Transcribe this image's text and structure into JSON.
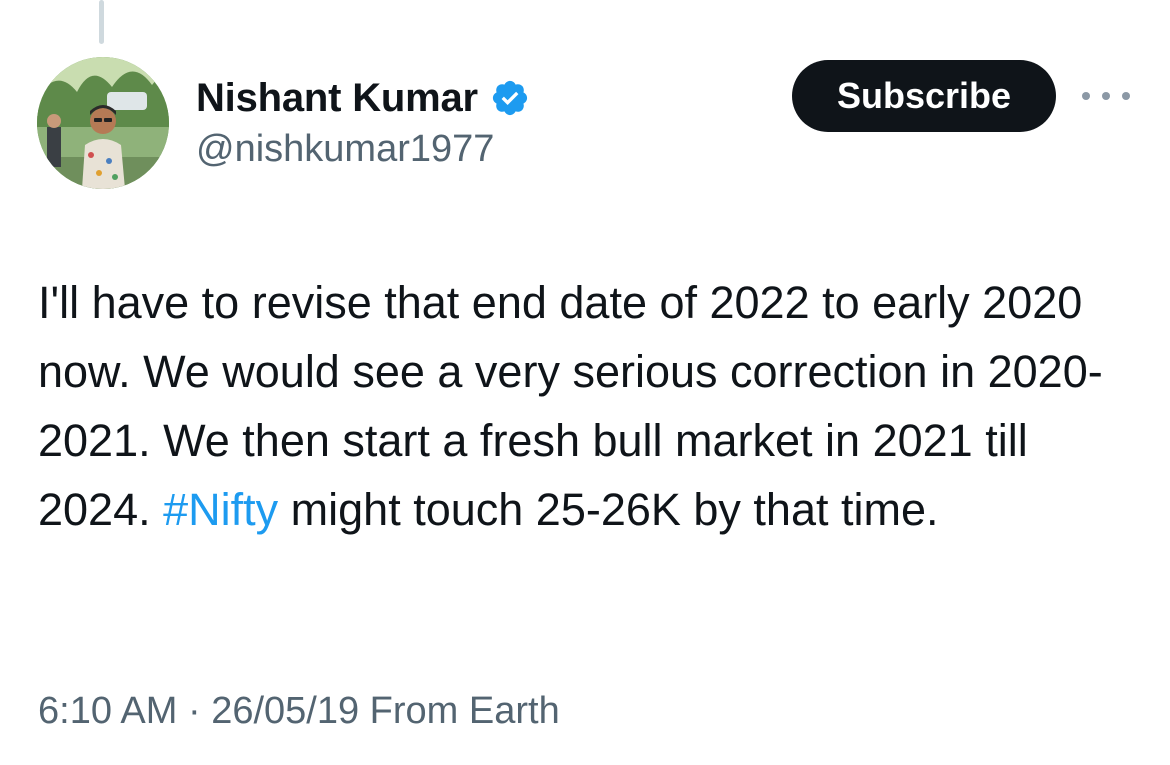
{
  "author": {
    "display_name": "Nishant Kumar",
    "handle": "@nishkumar1977",
    "verified": true,
    "verified_icon": "verified-badge-icon"
  },
  "actions": {
    "subscribe_label": "Subscribe",
    "more_icon": "more-options-icon"
  },
  "tweet": {
    "text_before_hashtag": "I'll have to revise that end date of 2022 to early 2020 now. We would see a very serious correction in 2020-2021. We then start a fresh bull market in 2021 till 2024. ",
    "hashtag": "#Nifty",
    "text_after_hashtag": " might touch 25-26K by that time."
  },
  "meta": {
    "time": "6:10 AM",
    "separator": " · ",
    "date": "26/05/19",
    "source": " From Earth"
  },
  "colors": {
    "text": "#0f1419",
    "secondary_text": "#536471",
    "link": "#1d9bf0",
    "verified": "#1d9bf0",
    "button_bg": "#0f1419"
  }
}
